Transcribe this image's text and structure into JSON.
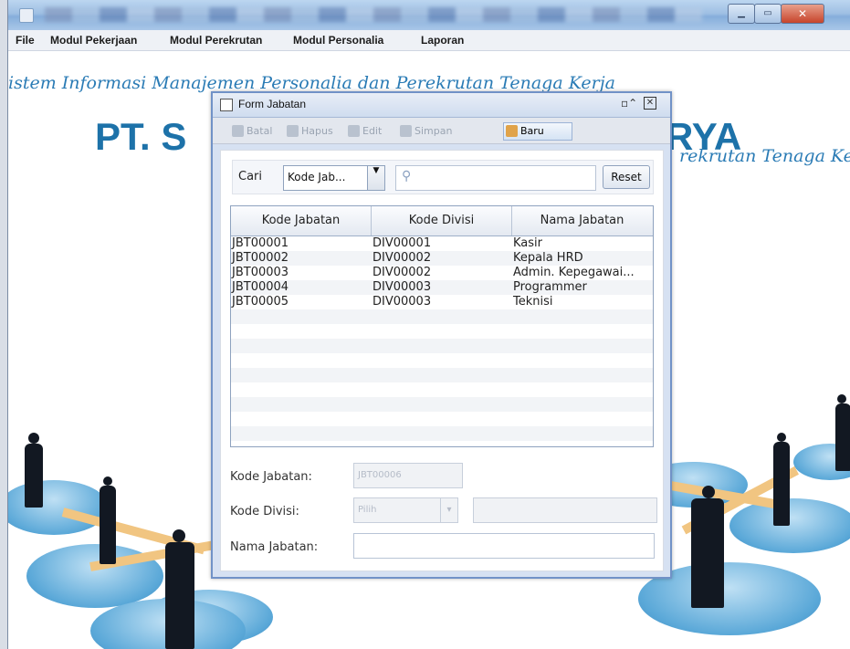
{
  "app": {
    "menu": [
      "File",
      "Modul Pekerjaan",
      "Modul Perekrutan",
      "Modul Personalia",
      "Laporan"
    ],
    "tagline_left": "istem Informasi Manajemen Personalia dan Perekrutan Tenaga Kerja",
    "company_left": "PT. S",
    "company_right": "RYA",
    "tagline_right": "rekrutan Tenaga Ke"
  },
  "frame": {
    "title": "Form Jabatan",
    "toolbar": [
      "Batal",
      "Hapus",
      "Edit",
      "Simpan",
      "Baru"
    ],
    "search": {
      "label": "Cari",
      "selected": "Kode Jab...",
      "reset_label": "Reset"
    },
    "table": {
      "columns": [
        "Kode Jabatan",
        "Kode Divisi",
        "Nama Jabatan"
      ],
      "rows": [
        [
          "JBT00001",
          "DIV00001",
          "Kasir"
        ],
        [
          "JBT00002",
          "DIV00002",
          "Kepala HRD"
        ],
        [
          "JBT00003",
          "DIV00002",
          "Admin. Kepegawai..."
        ],
        [
          "JBT00004",
          "DIV00003",
          "Programmer"
        ],
        [
          "JBT00005",
          "DIV00003",
          "Teknisi"
        ]
      ]
    },
    "form": {
      "kode_jabatan_label": "Kode Jabatan:",
      "kode_jabatan_value": "JBT00006",
      "kode_divisi_label": "Kode Divisi:",
      "kode_divisi_value": "Pilih",
      "nama_jabatan_label": "Nama Jabatan:"
    }
  },
  "colors": {
    "accent": "#1d72a9",
    "frame_border": "#7192c7"
  }
}
